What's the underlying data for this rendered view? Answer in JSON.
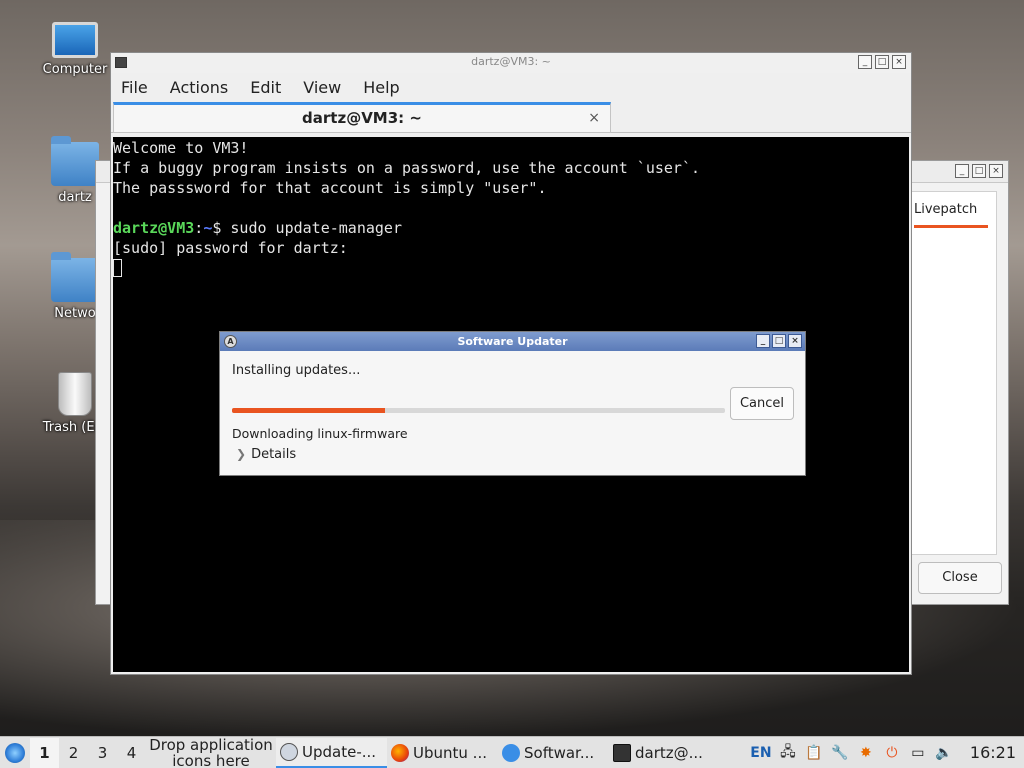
{
  "desktop": {
    "icons": [
      {
        "label": "Computer",
        "kind": "monitor"
      },
      {
        "label": "dartz",
        "kind": "home-folder"
      },
      {
        "label": "Netwo",
        "kind": "network-folder"
      },
      {
        "label": "Trash (Em",
        "kind": "trash"
      }
    ]
  },
  "back_window": {
    "tab_label": "Livepatch",
    "close_label": "Close"
  },
  "terminal": {
    "window_title": "dartz@VM3: ~",
    "menu": [
      "File",
      "Actions",
      "Edit",
      "View",
      "Help"
    ],
    "tab_title": "dartz@VM3: ~",
    "tab_close": "×",
    "lines": [
      "Welcome to VM3!",
      "If a buggy program insists on a password, use the account `user`.",
      "The passsword for that account is simply \"user\"."
    ],
    "prompt_user": "dartz@VM3",
    "prompt_sep": ":",
    "prompt_path": "~",
    "prompt_symbol": "$ ",
    "command": "sudo update-manager",
    "sudo_prompt": "[sudo] password for dartz:"
  },
  "dialog": {
    "title": "Software Updater",
    "status": "Installing updates...",
    "progress": 0.31,
    "cancel_label": "Cancel",
    "download_text": "Downloading linux-firmware",
    "details_label": "Details",
    "accent": "#e95420"
  },
  "taskbar": {
    "desktops": [
      "1",
      "2",
      "3",
      "4"
    ],
    "active_desktop": "1",
    "drop_text_1": "Drop application",
    "drop_text_2": "icons here",
    "tasks": [
      {
        "label": "Update-...",
        "icon": "software-updater-icon",
        "active": true
      },
      {
        "label": "Ubuntu ...",
        "icon": "firefox-icon",
        "active": false
      },
      {
        "label": "Softwar...",
        "icon": "software-updater-icon",
        "active": false
      },
      {
        "label": "dartz@...",
        "icon": "terminal-icon",
        "active": false
      }
    ],
    "keyboard_layout": "EN",
    "clock": "16:21"
  }
}
